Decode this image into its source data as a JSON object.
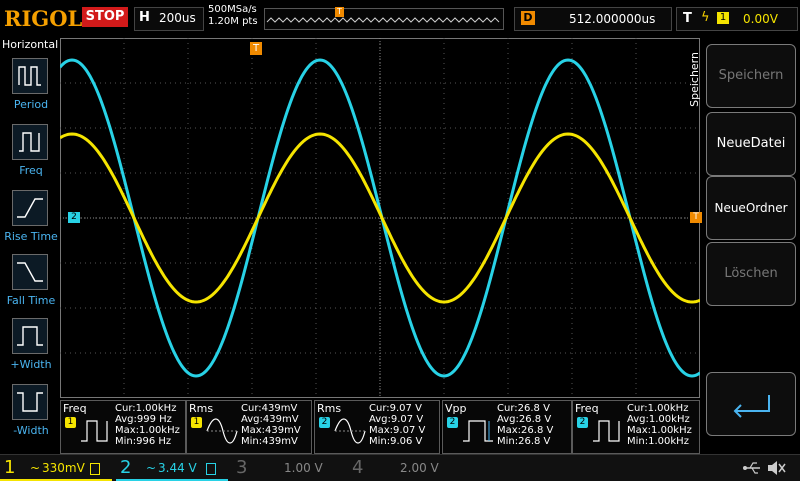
{
  "header": {
    "logo": "RIGOL",
    "run_state": "STOP",
    "horizontal": {
      "label": "H",
      "value": "200us"
    },
    "sample": {
      "rate": "500MSa/s",
      "points": "1.20M pts"
    },
    "trigger_position_marker": "T",
    "delay": {
      "label": "D",
      "value": "512.000000us"
    },
    "trigger": {
      "label": "T",
      "slope": "ϟ",
      "source": "1",
      "level": "0.00V"
    }
  },
  "left_menu": {
    "title": "Horizontal",
    "items": [
      {
        "label": "Period",
        "icon": "period-icon"
      },
      {
        "label": "Freq",
        "icon": "freq-icon"
      },
      {
        "label": "Rise Time",
        "icon": "rise-time-icon"
      },
      {
        "label": "Fall Time",
        "icon": "fall-time-icon"
      },
      {
        "label": "+Width",
        "icon": "pos-width-icon"
      },
      {
        "label": "-Width",
        "icon": "neg-width-icon"
      }
    ]
  },
  "right_menu": {
    "title": "Speichern",
    "buttons": [
      {
        "label": "Speichern",
        "enabled": false
      },
      {
        "label": "NeueDatei",
        "enabled": true
      },
      {
        "label": "NeueOrdner",
        "enabled": true
      },
      {
        "label": "Löschen",
        "enabled": false
      },
      {
        "label": "",
        "icon": "enter-icon",
        "enabled": true
      }
    ]
  },
  "markers": {
    "ch2_offset": "2",
    "trigger_level": "T"
  },
  "measurements": [
    {
      "name": "Freq",
      "channel": "1",
      "cur": "Cur:1.00kHz",
      "avg": "Avg:999 Hz",
      "max": "Max:1.00kHz",
      "min": "Min:996 Hz"
    },
    {
      "name": "Rms",
      "channel": "1",
      "cur": "Cur:439mV",
      "avg": "Avg:439mV",
      "max": "Max:439mV",
      "min": "Min:439mV"
    },
    {
      "name": "Rms",
      "channel": "2",
      "cur": "Cur:9.07 V",
      "avg": "Avg:9.07 V",
      "max": "Max:9.07 V",
      "min": "Min:9.06 V"
    },
    {
      "name": "Vpp",
      "channel": "2",
      "cur": "Cur:26.8 V",
      "avg": "Avg:26.8 V",
      "max": "Max:26.8 V",
      "min": "Min:26.8 V"
    },
    {
      "name": "Freq",
      "channel": "2",
      "cur": "Cur:1.00kHz",
      "avg": "Avg:1.00kHz",
      "max": "Max:1.00kHz",
      "min": "Min:1.00kHz"
    }
  ],
  "channels": [
    {
      "num": "1",
      "coupling": "~",
      "scale": "330mV",
      "color": "#f5e400",
      "active": true
    },
    {
      "num": "2",
      "coupling": "~",
      "scale": "3.44 V",
      "color": "#28d2e6",
      "active": true
    },
    {
      "num": "3",
      "coupling": "",
      "scale": "1.00 V",
      "color": "#666666",
      "active": false
    },
    {
      "num": "4",
      "coupling": "",
      "scale": "2.00 V",
      "color": "#666666",
      "active": false
    }
  ],
  "colors": {
    "ch1": "#f5e400",
    "ch2": "#28d2e6",
    "accent": "#f08a00",
    "menu": "#4ab4f0"
  }
}
